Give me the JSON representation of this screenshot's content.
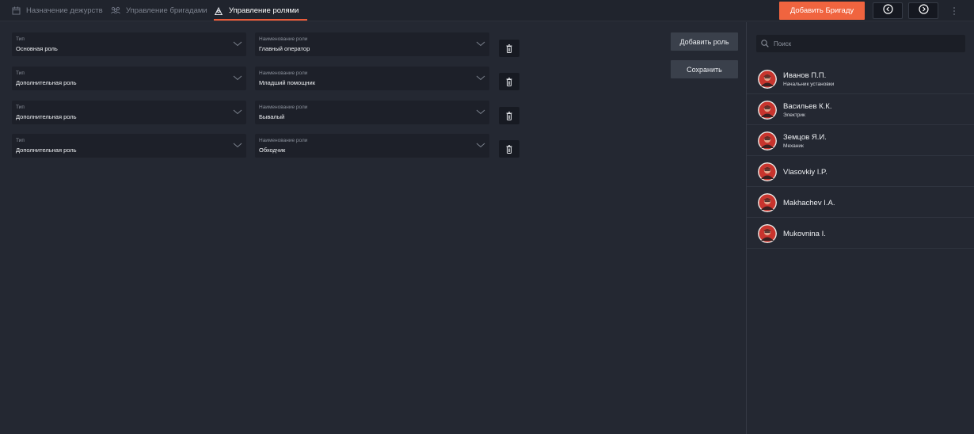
{
  "tabs": [
    {
      "label": "Назначение дежурств",
      "icon": "calendar-icon",
      "active": false
    },
    {
      "label": "Управление бригадами",
      "icon": "team-icon",
      "active": false
    },
    {
      "label": "Управление ролями",
      "icon": "roles-icon",
      "active": true
    }
  ],
  "header": {
    "add_brigade_label": "Добавить Бригаду",
    "prev_icon": "chevron-left-icon",
    "next_icon": "chevron-right-icon",
    "menu_icon": "more-vertical-icon"
  },
  "roles": [
    {
      "type_label": "Тип",
      "type_value": "Основная роль",
      "name_label": "Наименование роли",
      "name_value": "Главный оператор"
    },
    {
      "type_label": "Тип",
      "type_value": "Дополнительная роль",
      "name_label": "Наименование роли",
      "name_value": "Младший помощник"
    },
    {
      "type_label": "Тип",
      "type_value": "Дополнительная роль",
      "name_label": "Наименование роли",
      "name_value": "Бывалый"
    },
    {
      "type_label": "Тип",
      "type_value": "Дополнительная роль",
      "name_label": "Наименование роли",
      "name_value": "Обходчик"
    }
  ],
  "actions": {
    "add_role_label": "Добавить роль",
    "save_label": "Сохранить"
  },
  "search": {
    "placeholder": "Поиск",
    "value": ""
  },
  "people": [
    {
      "name": "Иванов П.П.",
      "position": "Начальник установки"
    },
    {
      "name": "Васильев К.К.",
      "position": "Электрик"
    },
    {
      "name": "Земцов Я.И.",
      "position": "Механик"
    },
    {
      "name": "Vlasovkiy I.P.",
      "position": ""
    },
    {
      "name": "Makhachev I.A.",
      "position": ""
    },
    {
      "name": "Mukovnina I.",
      "position": ""
    }
  ],
  "colors": {
    "accent": "#f0643f",
    "background": "#242832",
    "field": "#1d2029"
  }
}
